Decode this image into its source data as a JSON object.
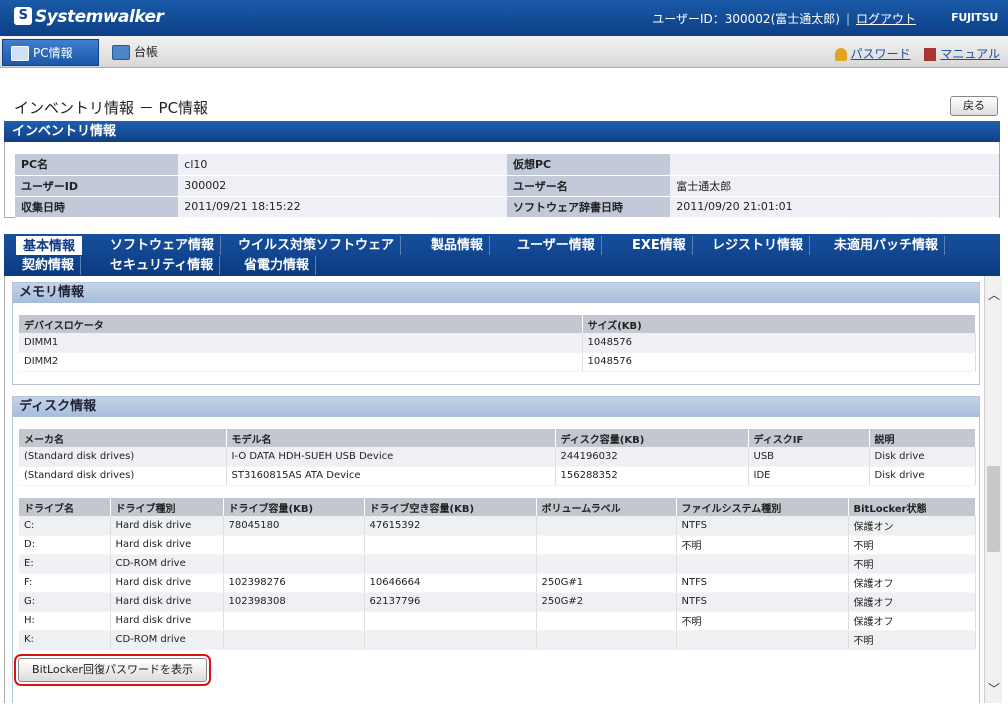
{
  "topbar": {
    "app_name": "Systemwalker",
    "user_text": "ユーザーID：300002(富士通太郎)",
    "logout": "ログアウト",
    "brand": "FUJITSU"
  },
  "menubar": {
    "tab_pc": "PC情報",
    "tab_daicho": "台帳",
    "password": "パスワード",
    "manual": "マニュアル"
  },
  "page": {
    "title": "インベントリ情報 － PC情報",
    "back": "戻る"
  },
  "inventory": {
    "header": "インベントリ情報",
    "rows": [
      {
        "l1": "PC名",
        "v1": "cl10",
        "l2": "仮想PC",
        "v2": ""
      },
      {
        "l1": "ユーザーID",
        "v1": "300002",
        "l2": "ユーザー名",
        "v2": "富士通太郎"
      },
      {
        "l1": "収集日時",
        "v1": "2011/09/21 18:15:22",
        "l2": "ソフトウェア辞書日時",
        "v2": "2011/09/20 21:01:01"
      }
    ]
  },
  "tabs": [
    "基本情報",
    "ソフトウェア情報",
    "ウイルス対策ソフトウェア",
    "製品情報",
    "ユーザー情報",
    "EXE情報",
    "レジストリ情報",
    "未適用パッチ情報",
    "契約情報",
    "セキュリティ情報",
    "省電力情報"
  ],
  "memory": {
    "title": "メモリ情報",
    "headers": [
      "デバイスロケータ",
      "サイズ(KB)"
    ],
    "rows": [
      [
        "DIMM1",
        "1048576"
      ],
      [
        "DIMM2",
        "1048576"
      ]
    ]
  },
  "disk": {
    "title": "ディスク情報",
    "headers": [
      "メーカ名",
      "モデル名",
      "ディスク容量(KB)",
      "ディスクIF",
      "説明"
    ],
    "rows": [
      [
        "(Standard disk drives)",
        "I-O DATA HDH-SUEH USB Device",
        "244196032",
        "USB",
        "Disk drive"
      ],
      [
        "(Standard disk drives)",
        "ST3160815AS ATA Device",
        "156288352",
        "IDE",
        "Disk drive"
      ]
    ]
  },
  "drives": {
    "headers": [
      "ドライブ名",
      "ドライブ種別",
      "ドライブ容量(KB)",
      "ドライブ空き容量(KB)",
      "ボリュームラベル",
      "ファイルシステム種別",
      "BitLocker状態"
    ],
    "rows": [
      [
        "C:",
        "Hard disk drive",
        "78045180",
        "47615392",
        "",
        "NTFS",
        "保護オン"
      ],
      [
        "D:",
        "Hard disk drive",
        "",
        "",
        "",
        "不明",
        "不明"
      ],
      [
        "E:",
        "CD-ROM drive",
        "",
        "",
        "",
        "",
        "不明"
      ],
      [
        "F:",
        "Hard disk drive",
        "102398276",
        "10646664",
        "250G#1",
        "NTFS",
        "保護オフ"
      ],
      [
        "G:",
        "Hard disk drive",
        "102398308",
        "62137796",
        "250G#2",
        "NTFS",
        "保護オフ"
      ],
      [
        "H:",
        "Hard disk drive",
        "",
        "",
        "",
        "不明",
        "保護オフ"
      ],
      [
        "K:",
        "CD-ROM drive",
        "",
        "",
        "",
        "",
        "不明"
      ]
    ],
    "button": "BitLocker回復パスワードを表示"
  }
}
